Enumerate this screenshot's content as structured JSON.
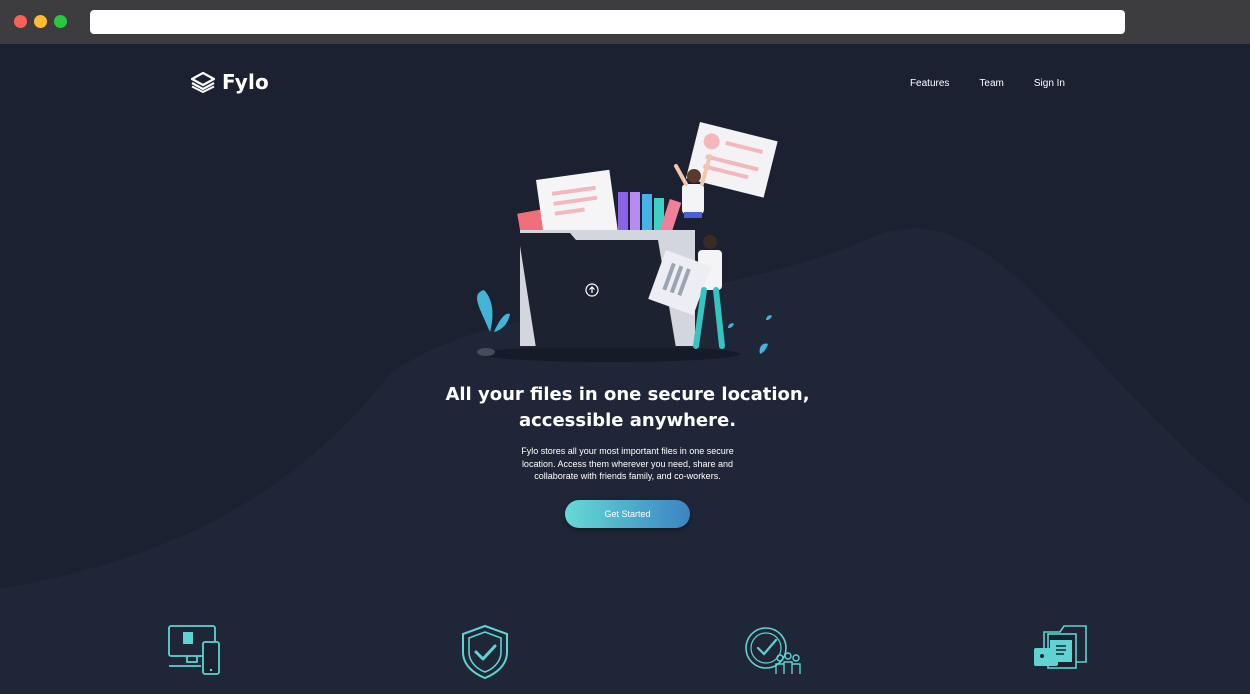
{
  "browser": {
    "address_value": ""
  },
  "nav": {
    "logo_text": "Fylo",
    "links": [
      "Features",
      "Team",
      "Sign In"
    ]
  },
  "hero": {
    "title_line1": "All your files in one secure location,",
    "title_line2": "accessible anywhere.",
    "description": "Fylo stores all your most important files in one secure location. Access them wherever you need, share and collaborate with friends family, and co-workers.",
    "cta_label": "Get Started"
  },
  "features": {
    "icons": [
      "devices-icon",
      "security-shield-icon",
      "collaboration-icon",
      "file-storage-icon"
    ]
  },
  "colors": {
    "background": "#1b2130",
    "curve": "#1f2637",
    "accent_cyan": "#65d9d4",
    "accent_blue": "#3a84c4",
    "traffic_red": "#fe5f57",
    "traffic_yellow": "#febc2e",
    "traffic_green": "#29c840"
  }
}
